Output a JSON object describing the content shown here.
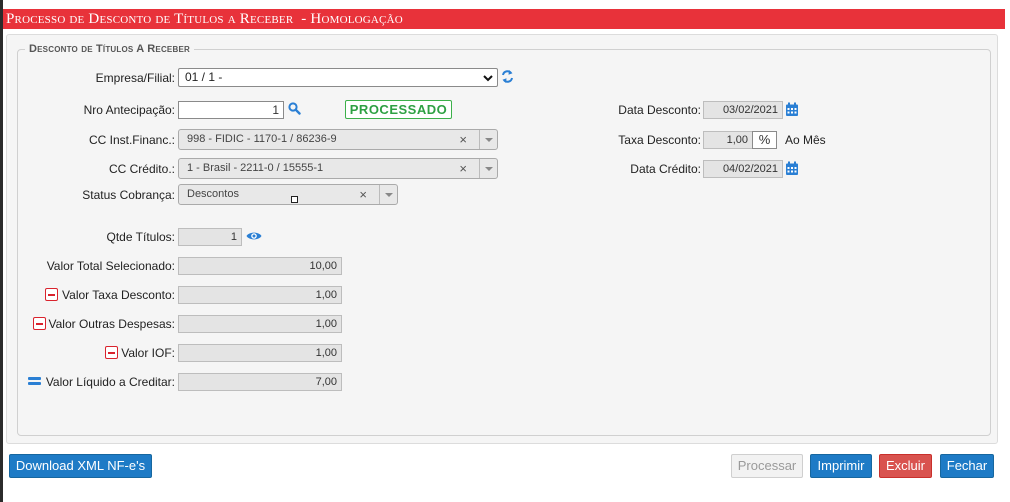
{
  "window": {
    "title": "Processo de Desconto de Títulos a Receber",
    "environment": "- Homologação"
  },
  "section": {
    "legend": "Desconto de Títulos A Receber"
  },
  "form": {
    "empresa_label": "Empresa/Filial:",
    "empresa_value": "01 / 1 -",
    "nro_label": "Nro Antecipação:",
    "nro_value": "1",
    "status_badge": "PROCESSADO",
    "cc_inst_label": "CC Inst.Financ.:",
    "cc_inst_value": "998 - FIDIC - 1170-1 / 86236-9",
    "cc_credito_label": "CC Crédito.:",
    "cc_credito_value": "1 - Brasil - 2211-0 / 15555-1",
    "status_cobranca_label": "Status Cobrança:",
    "status_cobranca_value": "Descontos",
    "clear_symbol": "×",
    "data_desconto_label": "Data Desconto:",
    "data_desconto_value": "03/02/2021",
    "taxa_label": "Taxa Desconto:",
    "taxa_value": "1,00",
    "taxa_unit": "%",
    "taxa_period": "Ao Mês",
    "data_credito_label": "Data Crédito:",
    "data_credito_value": "04/02/2021",
    "qtde_label": "Qtde Títulos:",
    "qtde_value": "1",
    "valor_total_label": "Valor Total Selecionado:",
    "valor_total_value": "10,00",
    "valor_taxa_label": "Valor Taxa Desconto:",
    "valor_taxa_value": "1,00",
    "valor_outras_label": "Valor Outras Despesas:",
    "valor_outras_value": "1,00",
    "valor_iof_label": "Valor IOF:",
    "valor_iof_value": "1,00",
    "valor_liquido_label": "Valor Líquido a Creditar:",
    "valor_liquido_value": "7,00"
  },
  "buttons": {
    "download": "Download XML NF-e's",
    "processar": "Processar",
    "imprimir": "Imprimir",
    "excluir": "Excluir",
    "fechar": "Fechar"
  },
  "icons": [
    "refresh-icon",
    "search-icon",
    "calendar-icon",
    "eye-icon",
    "minus-icon",
    "equals-icon",
    "chevron-down-icon"
  ],
  "colors": {
    "title_bar": "#e8323a",
    "primary_button": "#1e7bc6",
    "danger_button": "#d9534f",
    "badge_green": "#2ea043",
    "icon_blue": "#2a7fd4",
    "minus_red": "#d9232d"
  }
}
